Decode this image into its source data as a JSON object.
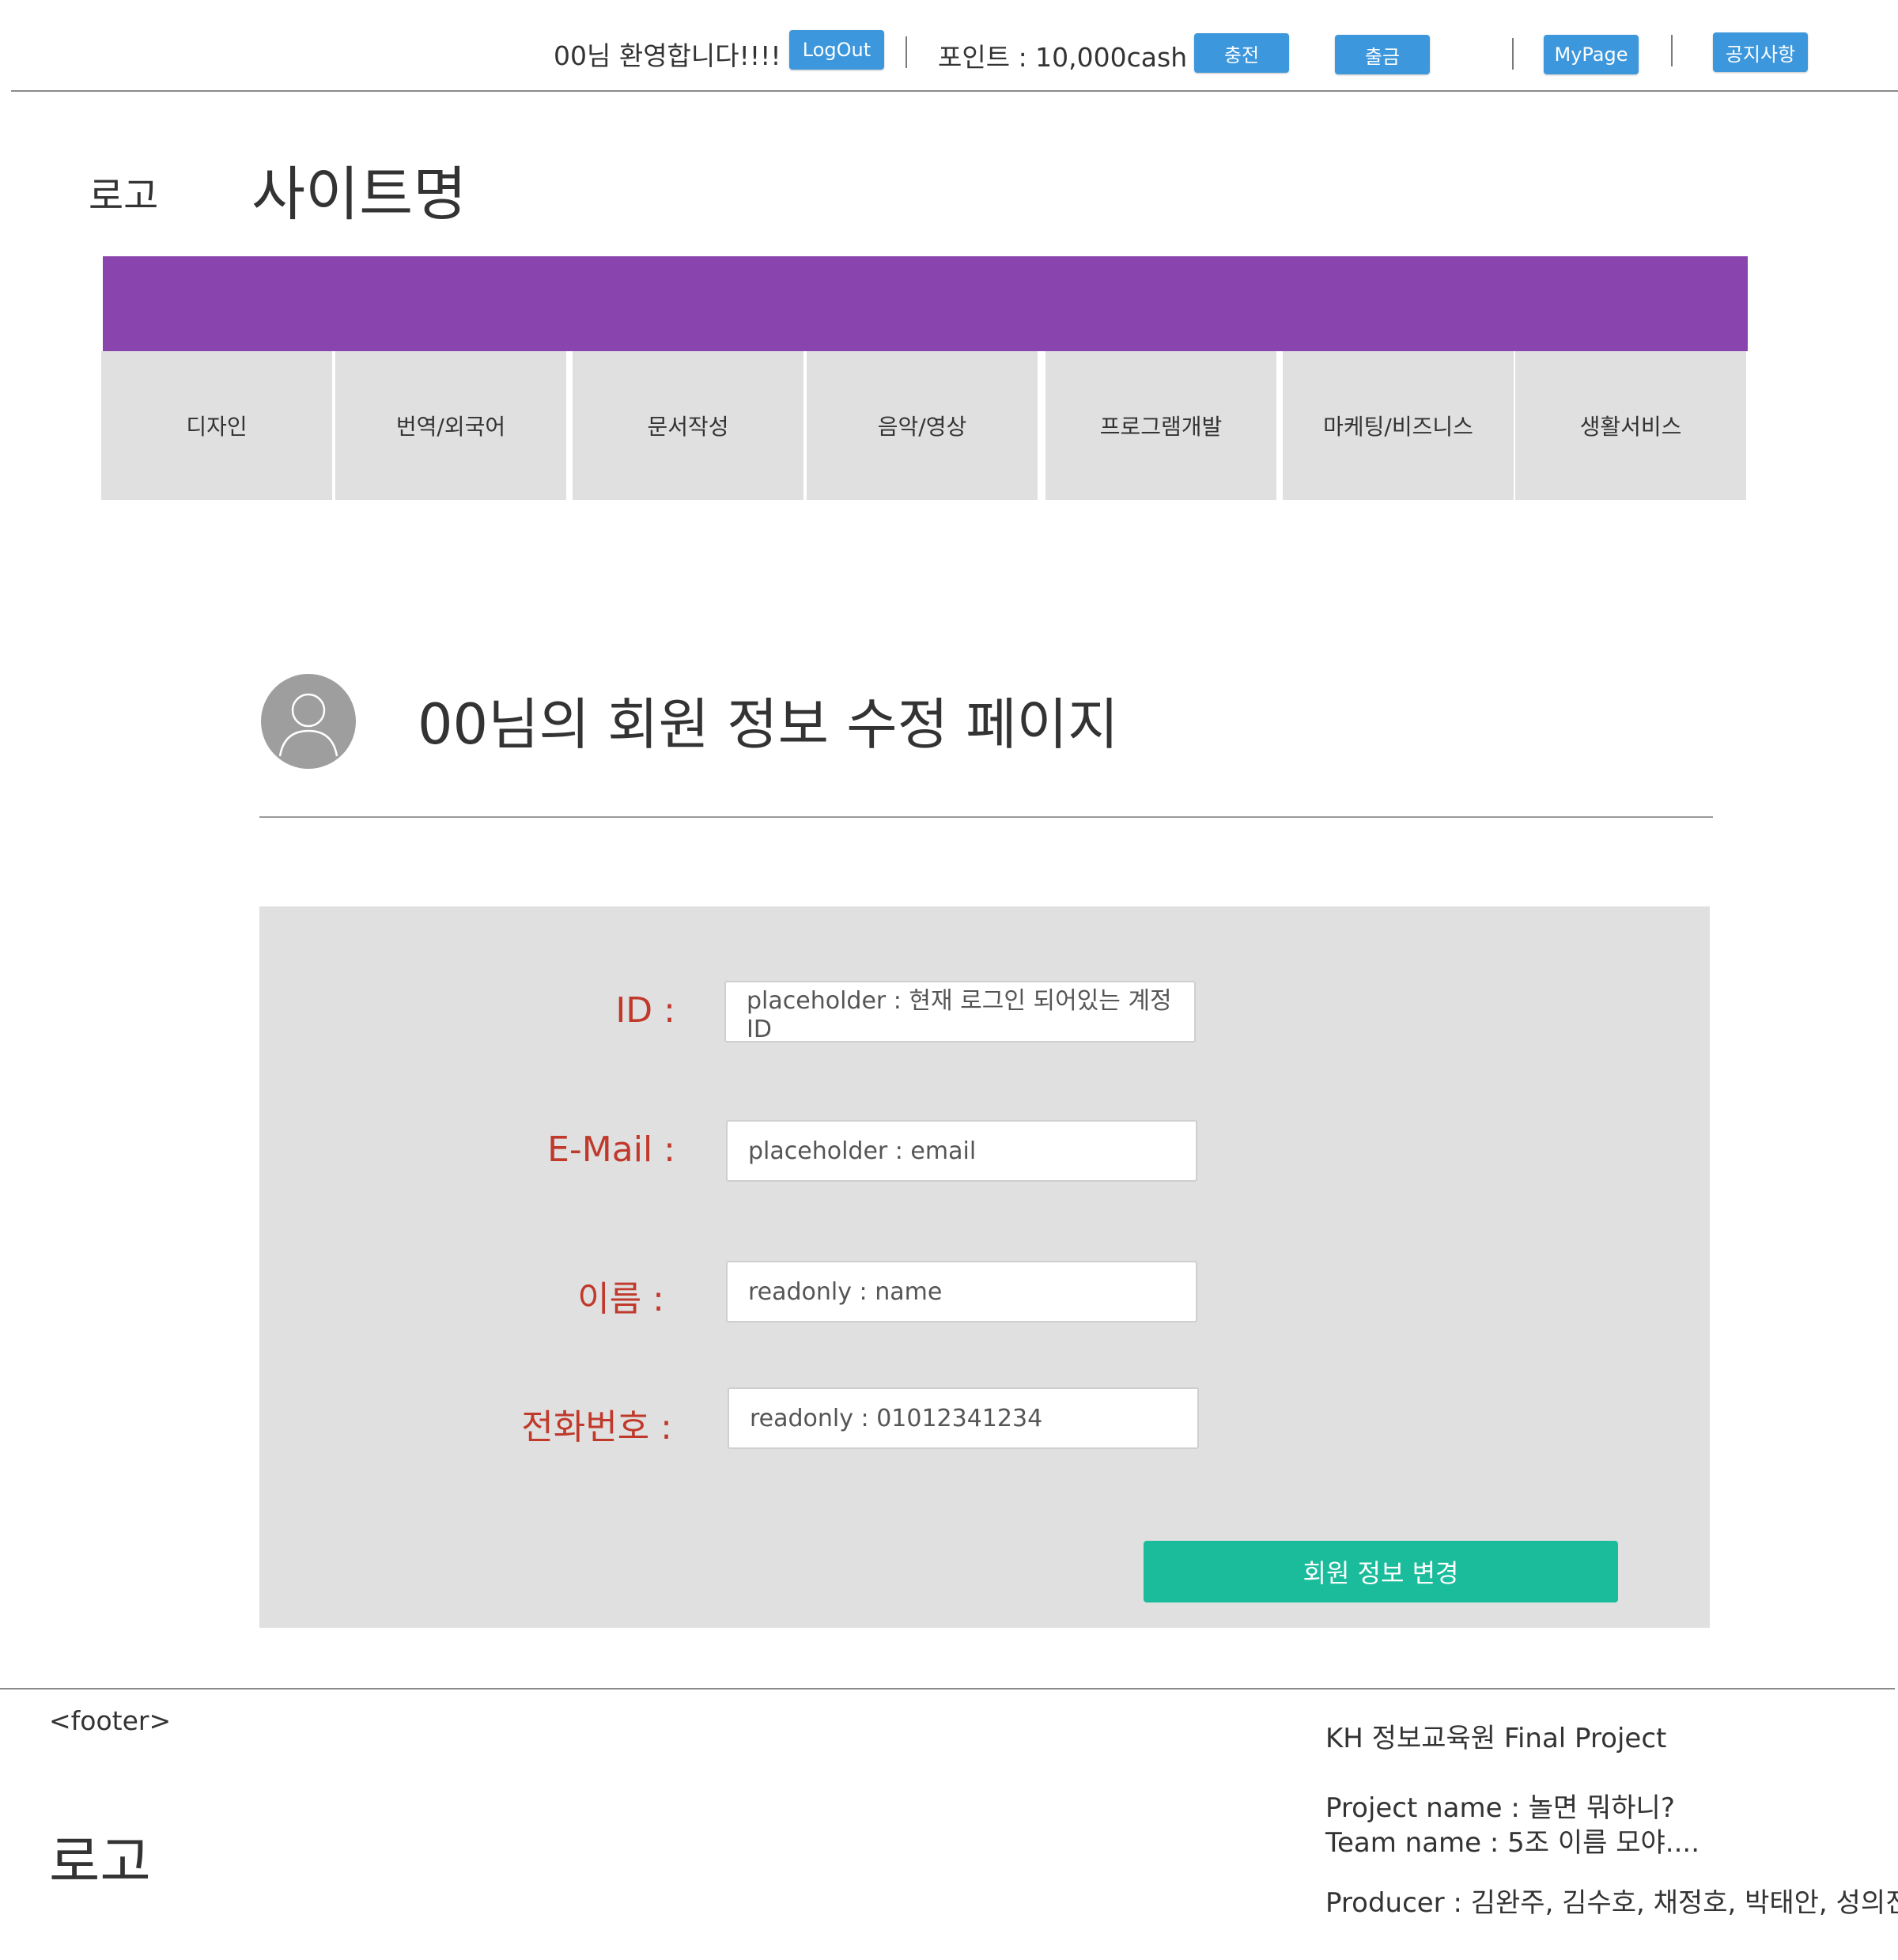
{
  "topbar": {
    "welcome": "00님 환영합니다!!!!",
    "logout_label": "LogOut",
    "points": "포인트 : 10,000cash",
    "charge_label": "충전",
    "withdraw_label": "출금",
    "mypage_label": "MyPage",
    "notice_label": "공지사항"
  },
  "header": {
    "logo": "로고",
    "site_name": "사이트명"
  },
  "categories": [
    {
      "label": "디자인"
    },
    {
      "label": "번역/외국어"
    },
    {
      "label": "문서작성"
    },
    {
      "label": "음악/영상"
    },
    {
      "label": "프로그램개발"
    },
    {
      "label": "마케팅/비즈니스"
    },
    {
      "label": "생활서비스"
    }
  ],
  "profile": {
    "title": "00님의 회원 정보 수정 페이지"
  },
  "form": {
    "fields": [
      {
        "label": "ID :",
        "value": "placeholder : 현재 로그인 되어있는 계정 ID"
      },
      {
        "label": "E-Mail :",
        "value": "placeholder : email"
      },
      {
        "label": "이름 :",
        "value": "readonly : name"
      },
      {
        "label": "전화번호 :",
        "value": "readonly : 01012341234"
      }
    ],
    "submit_label": "회원 정보 변경"
  },
  "footer": {
    "tag": "<footer>",
    "logo": "로고",
    "org": "KH 정보교육원 Final Project",
    "project_name": "Project name : 놀면 뭐하니?",
    "team_name": "Team name : 5조 이름 모야....",
    "producer": "Producer : 김완주, 김수호, 채정호, 박태안, 성의진"
  },
  "colors": {
    "nav_bar": "#8a44ad",
    "button_blue": "#3d97dc",
    "submit_green": "#1abc9c",
    "label_red": "#c0392b",
    "panel_gray": "#e0e0e0"
  }
}
